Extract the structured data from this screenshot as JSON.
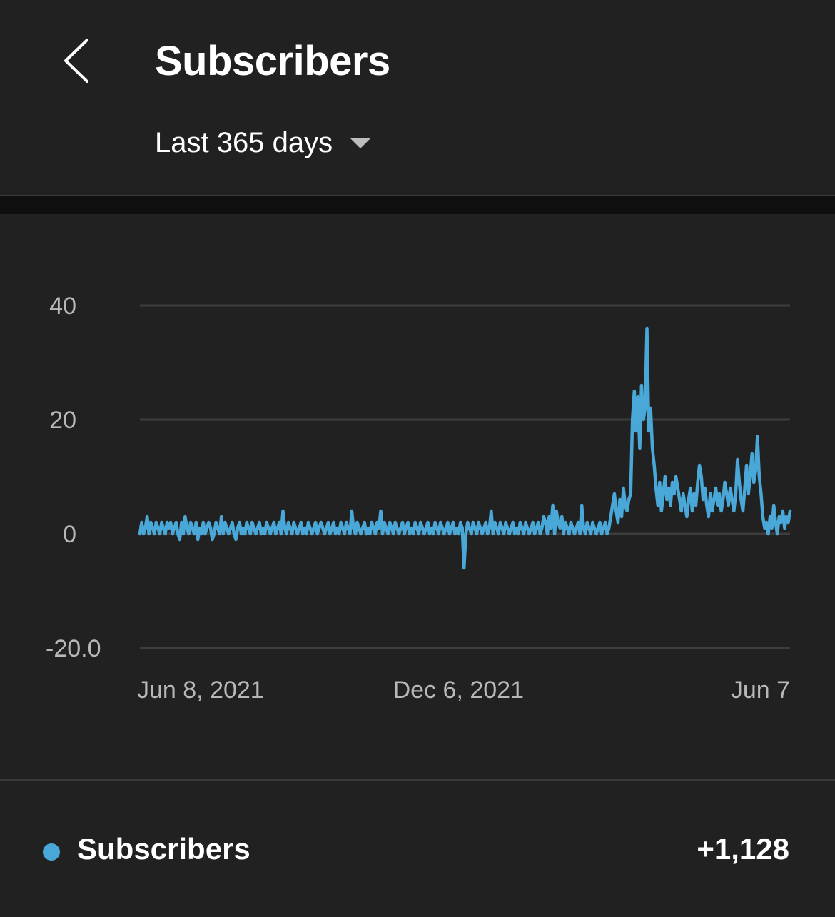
{
  "header": {
    "title": "Subscribers",
    "back_icon": "chevron-left-icon",
    "range": {
      "label": "Last 365 days",
      "icon": "caret-down-icon"
    }
  },
  "colors": {
    "background": "#212121",
    "series": "#4aa8d8",
    "grid": "#3d3d3d",
    "axis_text": "#b8b8b8"
  },
  "chart_data": {
    "type": "line",
    "ylim": [
      -20,
      40
    ],
    "y_ticks": [
      {
        "value": 40,
        "label": "40"
      },
      {
        "value": 20,
        "label": "20"
      },
      {
        "value": 0,
        "label": "0"
      },
      {
        "value": -20,
        "label": "-20.0"
      }
    ],
    "x_ticks": [
      {
        "index": 0,
        "label": "Jun 8, 2021"
      },
      {
        "index": 181,
        "label": "Dec 6, 2021"
      },
      {
        "index": 364,
        "label": "Jun 7"
      }
    ],
    "grid": true,
    "legend": "bottom",
    "series": [
      {
        "name": "Subscribers",
        "total": "+1,128",
        "values": [
          0,
          2,
          0,
          1,
          3,
          0,
          2,
          1,
          0,
          2,
          1,
          0,
          2,
          1,
          0,
          2,
          1,
          2,
          0,
          1,
          2,
          0,
          -1,
          2,
          0,
          3,
          1,
          0,
          2,
          1,
          0,
          2,
          -1,
          1,
          0,
          2,
          0,
          1,
          2,
          1,
          -1,
          0,
          2,
          1,
          0,
          3,
          0,
          2,
          1,
          0,
          1,
          2,
          0,
          -1,
          1,
          2,
          0,
          1,
          0,
          2,
          1,
          0,
          2,
          1,
          0,
          1,
          2,
          0,
          1,
          0,
          2,
          1,
          0,
          1,
          2,
          0,
          1,
          2,
          0,
          4,
          1,
          0,
          2,
          1,
          0,
          2,
          1,
          0,
          1,
          2,
          0,
          1,
          0,
          2,
          1,
          0,
          1,
          2,
          0,
          1,
          2,
          1,
          0,
          1,
          2,
          0,
          1,
          2,
          0,
          1,
          0,
          2,
          1,
          0,
          2,
          1,
          0,
          4,
          1,
          0,
          2,
          1,
          0,
          1,
          2,
          0,
          1,
          0,
          2,
          1,
          0,
          2,
          1,
          4,
          0,
          2,
          1,
          0,
          2,
          1,
          0,
          2,
          1,
          0,
          1,
          2,
          0,
          1,
          2,
          0,
          1,
          0,
          2,
          1,
          0,
          2,
          1,
          0,
          1,
          2,
          0,
          1,
          0,
          2,
          1,
          0,
          2,
          1,
          0,
          1,
          2,
          0,
          1,
          2,
          0,
          1,
          0,
          2,
          1,
          -6,
          0,
          2,
          1,
          0,
          2,
          1,
          0,
          2,
          1,
          0,
          1,
          2,
          0,
          1,
          4,
          0,
          2,
          1,
          0,
          2,
          1,
          0,
          2,
          1,
          0,
          1,
          2,
          0,
          1,
          0,
          2,
          1,
          0,
          2,
          1,
          0,
          1,
          2,
          0,
          1,
          2,
          0,
          1,
          3,
          2,
          0,
          3,
          1,
          5,
          0,
          4,
          2,
          1,
          3,
          0,
          2,
          1,
          0,
          2,
          1,
          0,
          1,
          2,
          0,
          5,
          1,
          0,
          2,
          1,
          0,
          2,
          1,
          0,
          1,
          2,
          0,
          1,
          2,
          0,
          1,
          3,
          5,
          7,
          4,
          2,
          6,
          3,
          8,
          5,
          4,
          6,
          7,
          20,
          25,
          18,
          24,
          15,
          26,
          20,
          22,
          36,
          18,
          22,
          15,
          12,
          8,
          5,
          9,
          4,
          7,
          10,
          6,
          8,
          5,
          9,
          7,
          10,
          8,
          6,
          4,
          7,
          5,
          3,
          6,
          8,
          4,
          7,
          5,
          9,
          12,
          10,
          6,
          8,
          5,
          3,
          7,
          4,
          6,
          8,
          5,
          7,
          4,
          6,
          9,
          7,
          5,
          8,
          6,
          4,
          7,
          13,
          9,
          6,
          4,
          8,
          12,
          7,
          10,
          14,
          9,
          11,
          17,
          10,
          7,
          3,
          1,
          2,
          0,
          3,
          1,
          5,
          2,
          0,
          3,
          2,
          4,
          1,
          3,
          2,
          4
        ]
      }
    ]
  }
}
